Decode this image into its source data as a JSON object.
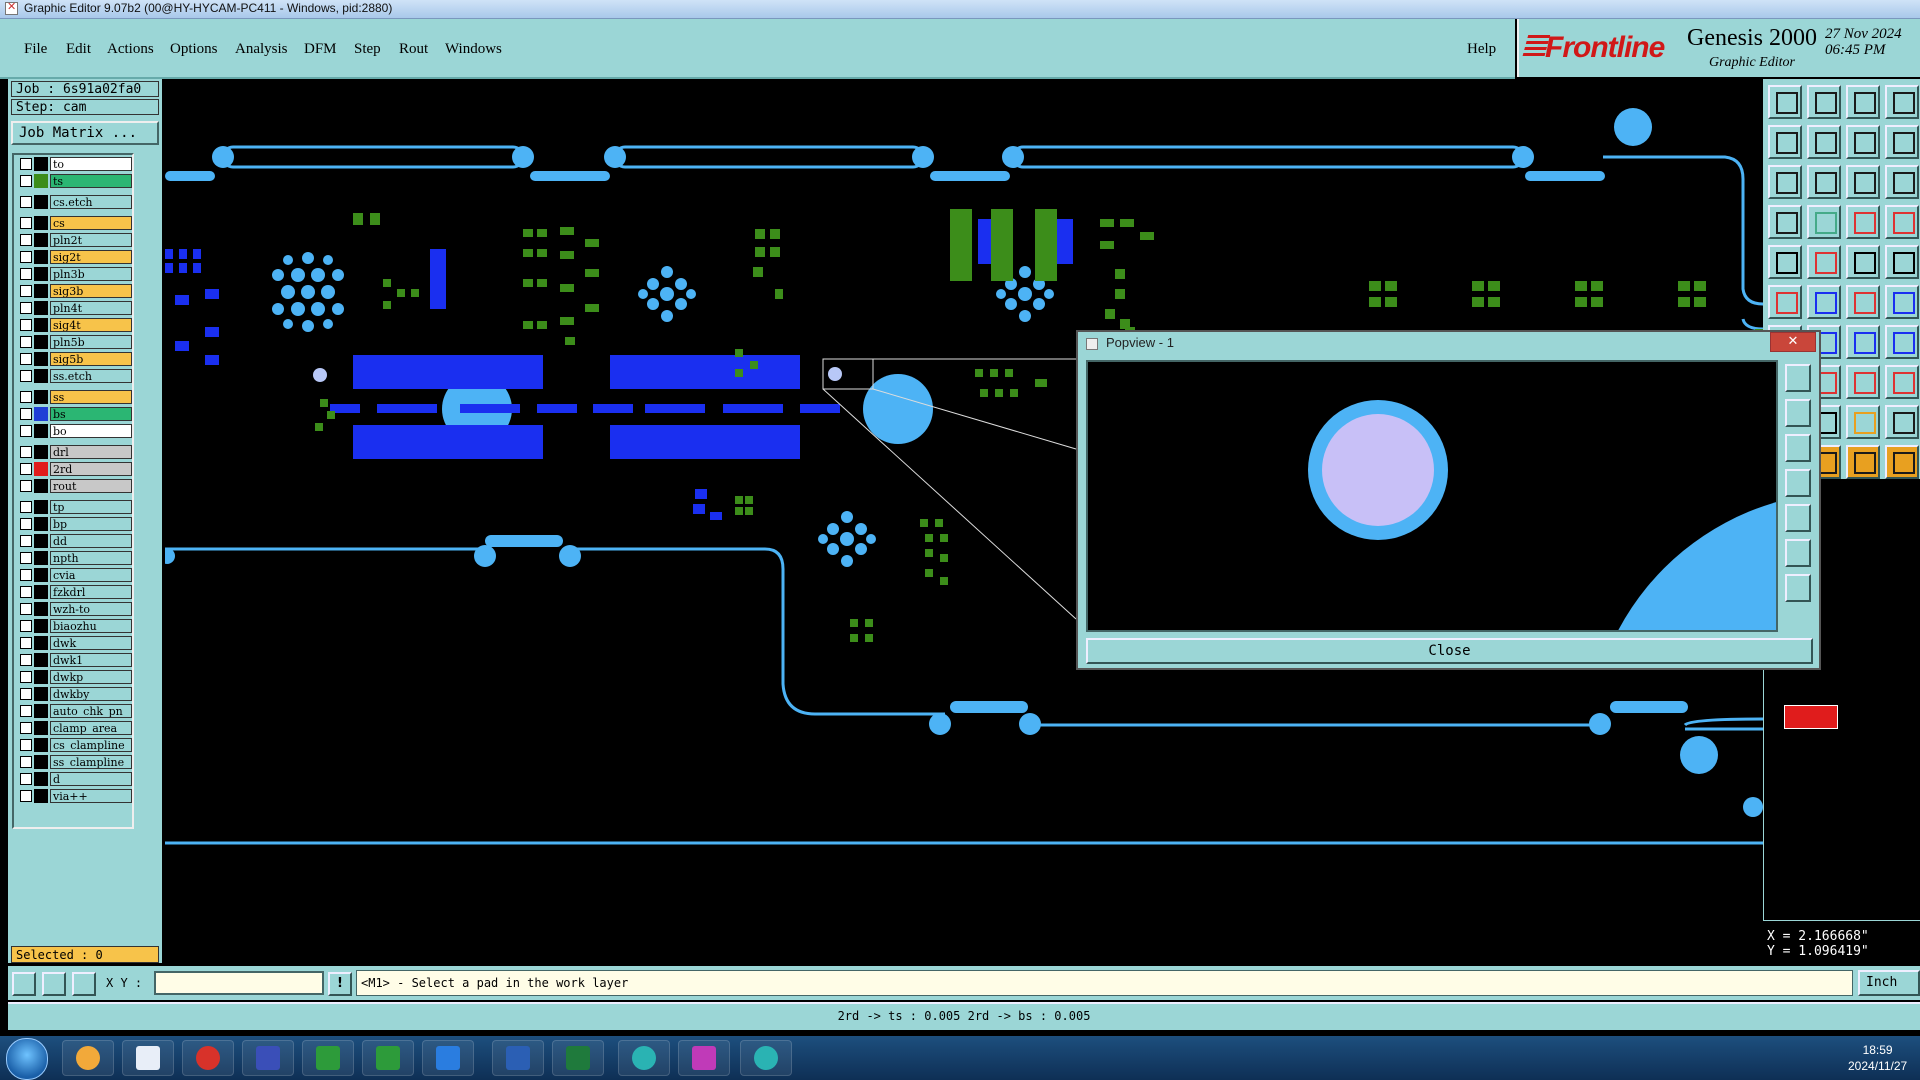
{
  "window": {
    "title": "Graphic Editor 9.07b2 (00@HY-HYCAM-PC411 - Windows, pid:2880)"
  },
  "menu": {
    "items": [
      "File",
      "Edit",
      "Actions",
      "Options",
      "Analysis",
      "DFM",
      "Step",
      "Rout",
      "Windows"
    ],
    "help": "Help"
  },
  "logo": {
    "brand": "Frontline",
    "product": "Genesis 2000",
    "subtitle": "Graphic Editor",
    "date": "27 Nov 2024",
    "time": "06:45 PM"
  },
  "panel": {
    "job": "Job : 6s91a02fa0",
    "step": "Step: cam",
    "job_matrix": "Job Matrix ...",
    "selected": "Selected : 0"
  },
  "layers": [
    {
      "name": "to",
      "color": "#ffffff",
      "swatch": "#000000"
    },
    {
      "name": "ts",
      "color": "#2bb673",
      "swatch": "#3c8d1a"
    },
    {
      "name": "cs.etch",
      "color": "#9bd6d6",
      "swatch": "#000000"
    },
    {
      "name": "cs",
      "color": "#f7c34a",
      "swatch": "#000000"
    },
    {
      "name": "pln2t",
      "color": "#9bd6d6",
      "swatch": "#000000"
    },
    {
      "name": "sig2t",
      "color": "#f7c34a",
      "swatch": "#000000"
    },
    {
      "name": "pln3b",
      "color": "#9bd6d6",
      "swatch": "#000000"
    },
    {
      "name": "sig3b",
      "color": "#f7c34a",
      "swatch": "#000000"
    },
    {
      "name": "pln4t",
      "color": "#9bd6d6",
      "swatch": "#000000"
    },
    {
      "name": "sig4t",
      "color": "#f7c34a",
      "swatch": "#000000"
    },
    {
      "name": "pln5b",
      "color": "#9bd6d6",
      "swatch": "#000000"
    },
    {
      "name": "sig5b",
      "color": "#f7c34a",
      "swatch": "#000000"
    },
    {
      "name": "ss.etch",
      "color": "#9bd6d6",
      "swatch": "#000000"
    },
    {
      "name": "ss",
      "color": "#f7c34a",
      "swatch": "#000000"
    },
    {
      "name": "bs",
      "color": "#2bb673",
      "swatch": "#1f3fd6"
    },
    {
      "name": "bo",
      "color": "#ffffff",
      "swatch": "#000000"
    },
    {
      "name": "drl",
      "color": "#c8c8c8",
      "swatch": "#000000"
    },
    {
      "name": "2rd",
      "color": "#c8c8c8",
      "swatch": "#e01c1c"
    },
    {
      "name": "rout",
      "color": "#c8c8c8",
      "swatch": "#000000"
    },
    {
      "name": "tp",
      "color": "#9bd6d6",
      "swatch": "#000000"
    },
    {
      "name": "bp",
      "color": "#9bd6d6",
      "swatch": "#000000"
    },
    {
      "name": "dd",
      "color": "#9bd6d6",
      "swatch": "#000000"
    },
    {
      "name": "npth",
      "color": "#9bd6d6",
      "swatch": "#000000"
    },
    {
      "name": "cvia",
      "color": "#9bd6d6",
      "swatch": "#000000"
    },
    {
      "name": "fzkdrl",
      "color": "#9bd6d6",
      "swatch": "#000000"
    },
    {
      "name": "wzh-to",
      "color": "#9bd6d6",
      "swatch": "#000000"
    },
    {
      "name": "biaozhu",
      "color": "#9bd6d6",
      "swatch": "#000000"
    },
    {
      "name": "dwk",
      "color": "#9bd6d6",
      "swatch": "#000000"
    },
    {
      "name": "dwk1",
      "color": "#9bd6d6",
      "swatch": "#000000"
    },
    {
      "name": "dwkp",
      "color": "#9bd6d6",
      "swatch": "#000000"
    },
    {
      "name": "dwkby",
      "color": "#9bd6d6",
      "swatch": "#000000"
    },
    {
      "name": "auto_chk_pn",
      "color": "#9bd6d6",
      "swatch": "#000000"
    },
    {
      "name": "clamp_area",
      "color": "#9bd6d6",
      "swatch": "#000000"
    },
    {
      "name": "cs_clampline",
      "color": "#9bd6d6",
      "swatch": "#000000"
    },
    {
      "name": "ss_clampline",
      "color": "#9bd6d6",
      "swatch": "#000000"
    },
    {
      "name": "d",
      "color": "#9bd6d6",
      "swatch": "#000000"
    },
    {
      "name": "via++",
      "color": "#9bd6d6",
      "swatch": "#000000"
    }
  ],
  "popview": {
    "title": "Popview - 1",
    "close": "Close"
  },
  "coords": {
    "x": "X = 2.166668\"",
    "y": "Y = 1.096419\""
  },
  "cmd": {
    "xy_label": "X Y :",
    "xy_value": "",
    "message": "<M1> - Select a pad in the work layer",
    "units": "Inch"
  },
  "status": "2rd -> ts : 0.005    2rd -> bs : 0.005",
  "taskbar": {
    "time": "18:59",
    "date": "2024/11/27"
  },
  "colors": {
    "trace": "#4db3f5",
    "pad_blue": "#1a2ff0",
    "pad_green": "#3c8d1a",
    "panel": "#9bd6d6",
    "highlight_pad": "#c8c0f7"
  }
}
